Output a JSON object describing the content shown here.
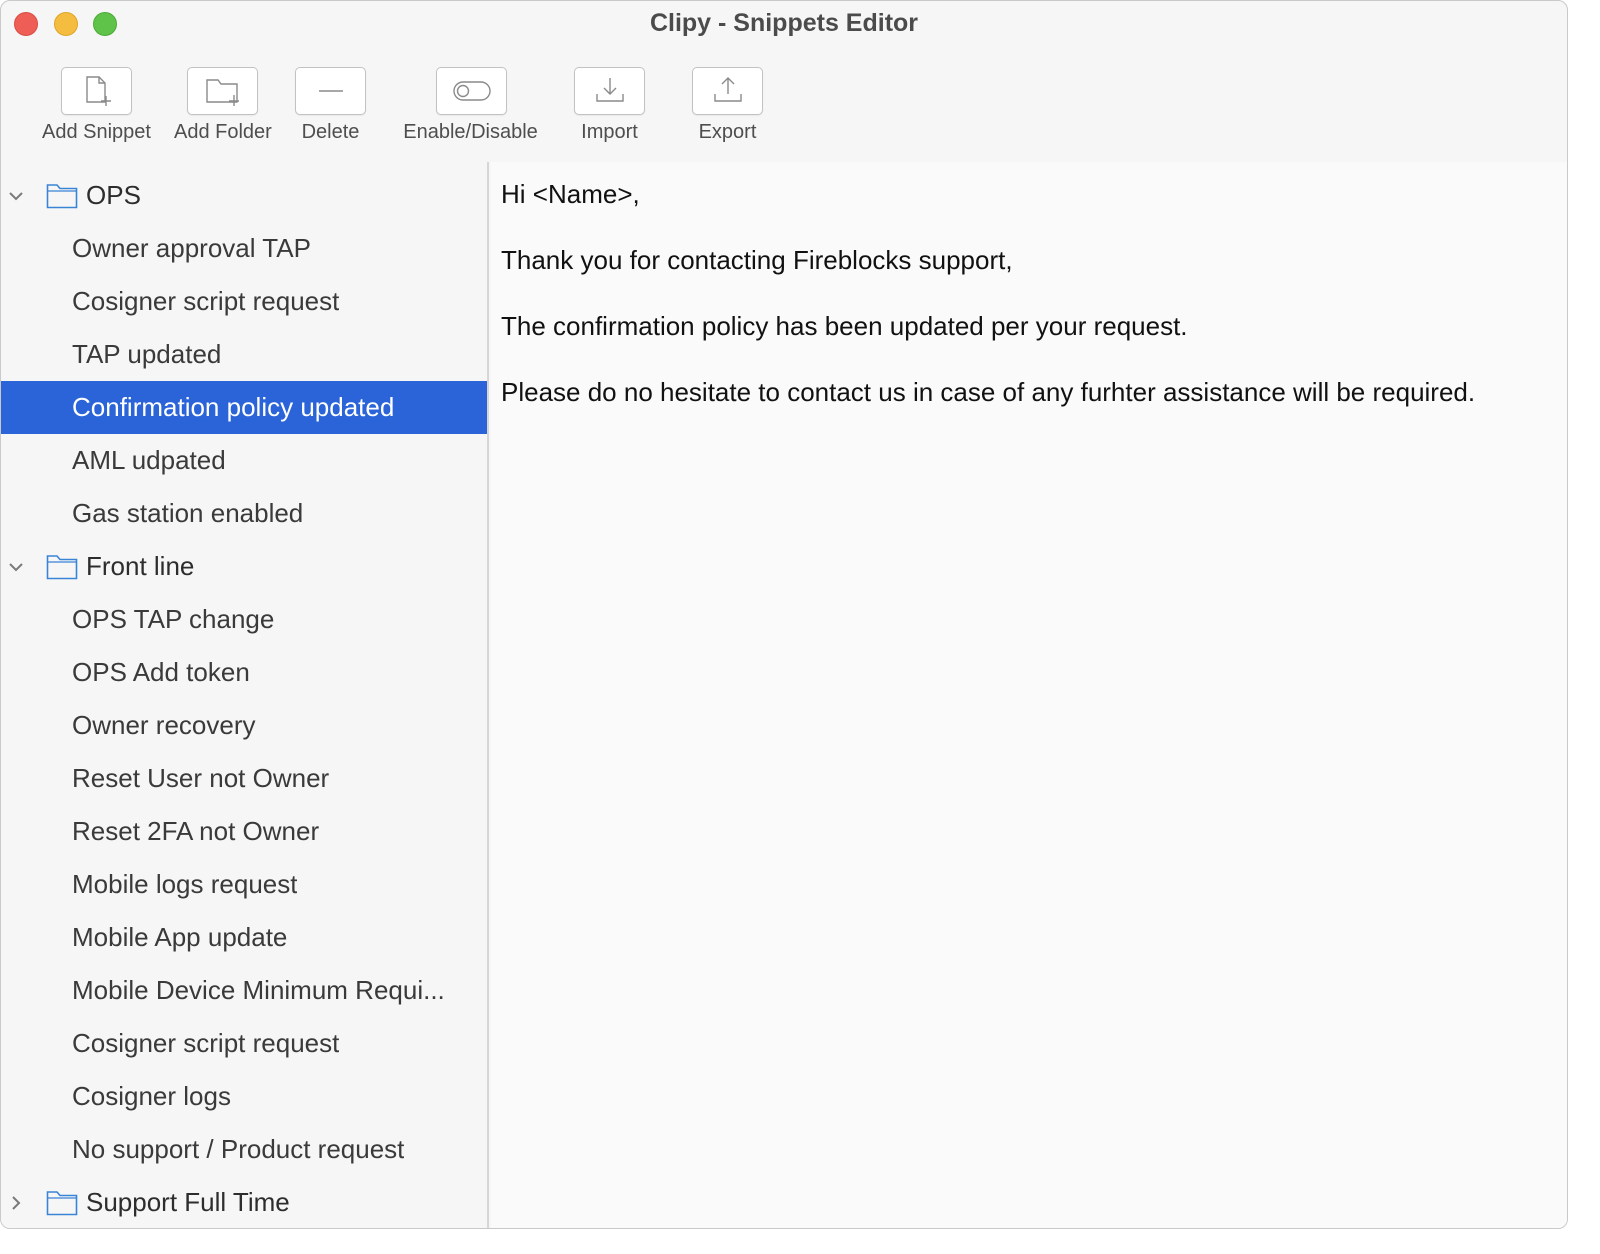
{
  "window": {
    "title": "Clipy - Snippets Editor"
  },
  "toolbar": {
    "buttons": [
      {
        "label": "Add Snippet",
        "icon": "add-snippet-icon"
      },
      {
        "label": "Add Folder",
        "icon": "add-folder-icon"
      },
      {
        "label": "Delete",
        "icon": "delete-icon"
      },
      {
        "label": "Enable/Disable",
        "icon": "toggle-icon"
      },
      {
        "label": "Import",
        "icon": "import-icon"
      },
      {
        "label": "Export",
        "icon": "export-icon"
      }
    ]
  },
  "sidebar": {
    "folders": [
      {
        "name": "OPS",
        "expanded": true,
        "snippets": [
          "Owner approval TAP",
          "Cosigner script request",
          "TAP updated",
          "Confirmation policy updated",
          "AML udpated",
          "Gas station enabled"
        ]
      },
      {
        "name": "Front line",
        "expanded": true,
        "snippets": [
          "OPS TAP change",
          "OPS Add token",
          "Owner recovery",
          "Reset User not Owner",
          "Reset 2FA not Owner",
          "Mobile logs request",
          "Mobile App update",
          "Mobile Device Minimum Requi...",
          "Cosigner script request",
          "Cosigner logs",
          "No support / Product request"
        ]
      },
      {
        "name": "Support Full Time",
        "expanded": false,
        "snippets": []
      }
    ],
    "selected_snippet": "Confirmation policy updated"
  },
  "editor": {
    "paragraphs": [
      "Hi <Name>,",
      "Thank you for contacting Fireblocks support,",
      "The confirmation policy has been updated per your request.",
      "Please do no hesitate to contact us in case of any furhter assistance will be required."
    ]
  },
  "colors": {
    "selection": "#2a64d8",
    "folder_icon": "#3a84d6",
    "close": "#ee5e57",
    "minimize": "#f5bd3f",
    "maximize": "#5ec348"
  }
}
